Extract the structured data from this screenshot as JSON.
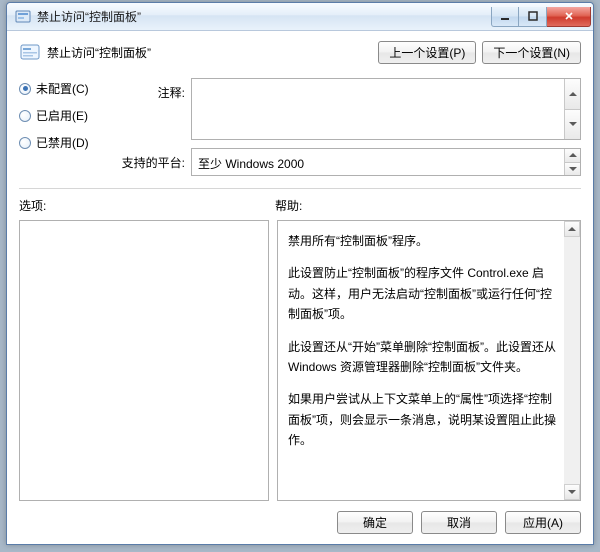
{
  "window": {
    "title": "禁止访问“控制面板”"
  },
  "header": {
    "title": "禁止访问“控制面板”",
    "prev_label": "上一个设置(P)",
    "next_label": "下一个设置(N)"
  },
  "radios": {
    "not_configured": "未配置(C)",
    "enabled": "已启用(E)",
    "disabled": "已禁用(D)",
    "selected": "not_configured"
  },
  "fields": {
    "comment_label": "注释:",
    "comment_value": "",
    "platform_label": "支持的平台:",
    "platform_value": "至少 Windows 2000"
  },
  "sections": {
    "options_label": "选项:",
    "help_label": "帮助:"
  },
  "help": {
    "p1": "禁用所有“控制面板”程序。",
    "p2": "此设置防止“控制面板”的程序文件 Control.exe 启动。这样，用户无法启动“控制面板”或运行任何“控制面板”项。",
    "p3": "此设置还从“开始”菜单删除“控制面板”。此设置还从 Windows 资源管理器删除“控制面板”文件夹。",
    "p4": "如果用户尝试从上下文菜单上的“属性”项选择“控制面板”项，则会显示一条消息，说明某设置阻止此操作。"
  },
  "footer": {
    "ok_label": "确定",
    "cancel_label": "取消",
    "apply_label": "应用(A)"
  }
}
